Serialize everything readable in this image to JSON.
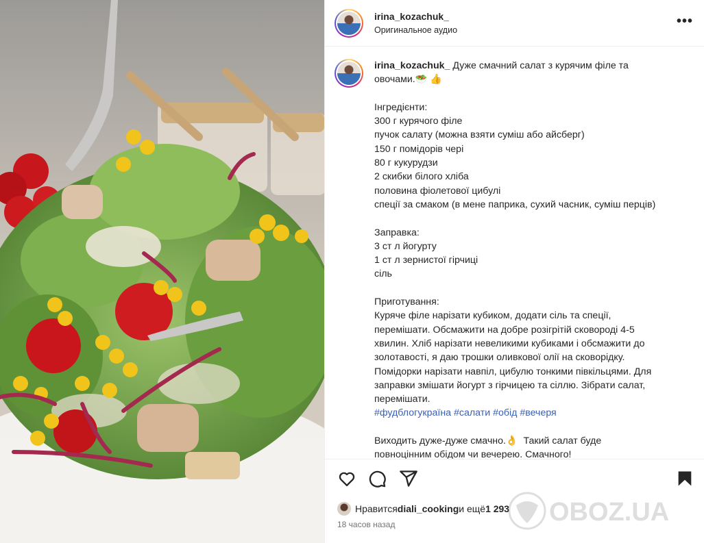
{
  "post": {
    "username": "irina_kozachuk_",
    "audio": "Оригинальное аудио",
    "more_label": "•••",
    "caption": {
      "username": "irina_kozachuk_",
      "text": " Дуже смачний салат з курячим філе та\nовочами.🥗 👍\n\nІнгредієнти:\n300 г курячого філе\nпучок салату (можна взяти суміш або айсберг)\n150 г помідорів чері\n80 г кукурудзи\n2 скибки білого хліба\nполовина фіолетової цибулі\nспеції за смаком (в мене паприка, сухий часник, суміш перців)\n\nЗаправка:\n3 ст л йогурту\n1 ст л зернистої гірчиці\nсіль\n\nПриготування:\nКуряче філе нарізати кубиком, додати сіль та спеції,\nперемішати. Обсмажити на добре розігрітій сковороді 4-5\nхвилин. Хліб нарізати невеликими кубиками і обсмажити до\nзолотавості, я даю трошки оливкової олії на сковорідку.\nПомідорки нарізати навпіл, цибулю тонкими півкільцями. Для\nзаправки змішати йогурт з гірчицею та сіллю. Зібрати салат,\nперемішати.",
      "hashtags": "#фудблогукраїна #салати #обід #вечеря",
      "ending": "\n\nВиходить дуже-дуже смачно.👌  Такий салат буде\nповноцінним обідом чи вечерею. Смачного!"
    },
    "likes": {
      "prefix": "Нравится ",
      "user": "diali_cooking",
      "middle": " и ещё ",
      "count": "1 293"
    },
    "timestamp": "18 часов назад"
  },
  "icons": [
    "heart-icon",
    "comment-icon",
    "share-icon",
    "bookmark-icon",
    "more-icon"
  ],
  "watermark": "OBOZ.UA"
}
